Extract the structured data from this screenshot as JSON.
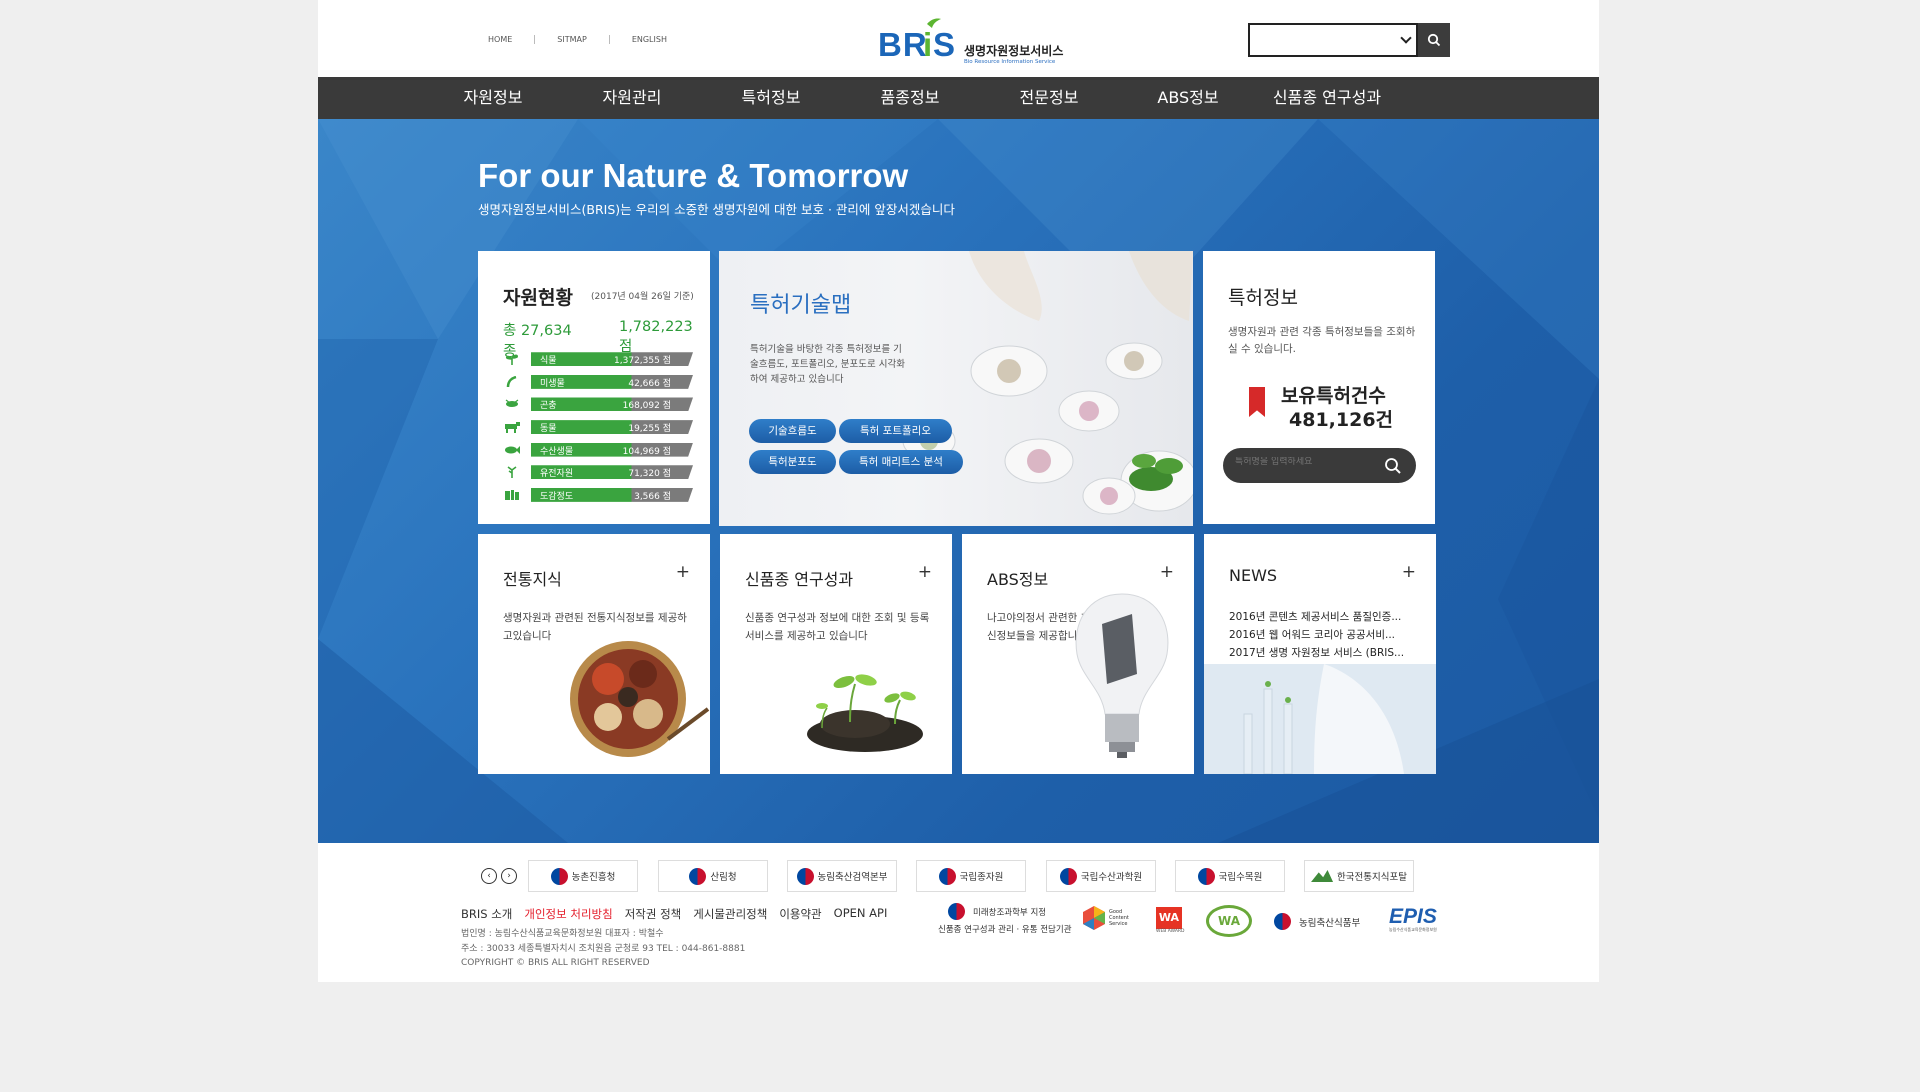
{
  "header": {
    "links": [
      "HOME",
      "SITMAP",
      "ENGLISH"
    ],
    "logo_text": "BRiS",
    "logo_ko": "생명자원정보서비스",
    "logo_en": "Bio Resource Information Service"
  },
  "nav": [
    "자원정보",
    "자원관리",
    "특허정보",
    "품종정보",
    "전문정보",
    "ABS정보",
    "신품종 연구성과"
  ],
  "hero": {
    "title": "For our Nature & Tomorrow",
    "subtitle": "생명자원정보서비스(BRIS)는 우리의 소중한 생명자원에 대한 보호 · 관리에 앞장서겠습니다"
  },
  "resources": {
    "title": "자원현황",
    "date": "(2017년 04월 26일 기준)",
    "total_species": "총 27,634 종",
    "total_items": "1,782,223 점",
    "rows": [
      {
        "label": "식물",
        "value": "1,372,355 점",
        "icon": "plant-icon"
      },
      {
        "label": "미생물",
        "value": "42,666 점",
        "icon": "microbe-icon"
      },
      {
        "label": "곤충",
        "value": "168,092 점",
        "icon": "insect-icon"
      },
      {
        "label": "동물",
        "value": "19,255 점",
        "icon": "animal-icon"
      },
      {
        "label": "수산생물",
        "value": "104,969 점",
        "icon": "fish-icon"
      },
      {
        "label": "유전자원",
        "value": "71,320 점",
        "icon": "gene-icon"
      },
      {
        "label": "도감정도",
        "value": "3,566 점",
        "icon": "book-icon"
      }
    ]
  },
  "patent_map": {
    "title": "특허기술맵",
    "desc": "특허기술을 바탕한 각종 특허정보를 기술흐름도, 포트폴리오, 분포도로 시각화하여 제공하고 있습니다",
    "buttons": [
      "기술흐름도",
      "특허 포트폴리오",
      "특허분포도",
      "특허 매리트스 분석"
    ]
  },
  "patent_info": {
    "title": "특허정보",
    "desc": "생명자원과 관련 각종 특허정보들을 조회하실 수 있습니다.",
    "count_label": "보유특허건수",
    "count": "481,126건",
    "search_placeholder": "특허명을 입력하세요"
  },
  "cards": [
    {
      "title": "전통지식",
      "desc": "생명자원과 관련된 전통지식정보를 제공하고있습니다",
      "plus": "+"
    },
    {
      "title": "신품종 연구성과",
      "desc": "신품종 연구성과 정보에 대한 조회 및 등록서비스를 제공하고 있습니다",
      "plus": "+"
    },
    {
      "title": "ABS정보",
      "desc": "나고야의정서 관련한 최신정보들을 제공합니다",
      "plus": "+"
    },
    {
      "title": "NEWS",
      "plus": "+",
      "items": [
        "2016년 콘텐츠 제공서비스 품질인증...",
        "2016년 웹 어워드 코리아 공공서비...",
        "2017년 생명 자원정보 서비스 (BRIS..."
      ]
    }
  ],
  "footer": {
    "partners": [
      "농촌진흥청",
      "산림청",
      "농림축산검역본부",
      "국립종자원",
      "국립수산과학원",
      "국립수목원",
      "한국전통지식포탈"
    ],
    "links": [
      "BRIS 소개",
      "개인정보 처리방침",
      "저작권 정책",
      "게시물관리정책",
      "이용약관",
      "OPEN API"
    ],
    "info": [
      "법인명 : 농림수산식품교육문화정보원 대표자 : 박철수",
      "주소 : 30033 세종특별자치시 조치원읍 군청로 93 TEL : 044-861-8881",
      "COPYRIGHT © BRIS ALL RIGHT RESERVED"
    ],
    "certs": {
      "designation_1": "미래창조과학부 지정",
      "designation_2": "신품종 연구성과 관리 · 유통 전담기관",
      "good_content_1": "Good",
      "good_content_2": "Content",
      "good_content_3": "Service",
      "wa_badge": "WA",
      "wa_label": "WEB AWARD",
      "wa_cert": "WA",
      "ministry": "농림축산식품부",
      "epis": "EPIS",
      "epis_sub": "농림수산식품교육문화정보원"
    }
  },
  "colors": {
    "nav_bg": "#3a3a3a",
    "hero_blue": "#2a73bd",
    "accent_green": "#3aa43f",
    "title_blue": "#2a6fc0",
    "patent_red": "#d62929"
  }
}
